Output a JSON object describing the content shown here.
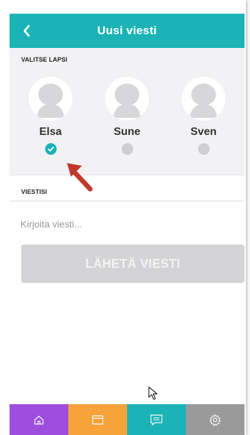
{
  "header": {
    "title": "Uusi viesti",
    "back_icon": "chevron-left-icon"
  },
  "children_section": {
    "label": "VALITSE LAPSI",
    "children": [
      {
        "name": "Elsa",
        "selected": true
      },
      {
        "name": "Sune",
        "selected": false
      },
      {
        "name": "Sven",
        "selected": false
      }
    ]
  },
  "message_section": {
    "label": "VIESTISI",
    "input_value": "",
    "input_placeholder": "Kirjoita viesti...",
    "send_label": "LÄHETÄ VIESTI"
  },
  "tabbar": {
    "tabs": [
      {
        "icon": "home-icon",
        "color": "#9d4edd"
      },
      {
        "icon": "calendar-icon",
        "color": "#f7a23b"
      },
      {
        "icon": "messages-icon",
        "color": "#1bb3b6"
      },
      {
        "icon": "settings-icon",
        "color": "#9a9a9a"
      }
    ]
  },
  "colors": {
    "accent": "#1bb3b6",
    "button_disabled": "#d4d4d6",
    "annotation_arrow": "#c0392b"
  }
}
